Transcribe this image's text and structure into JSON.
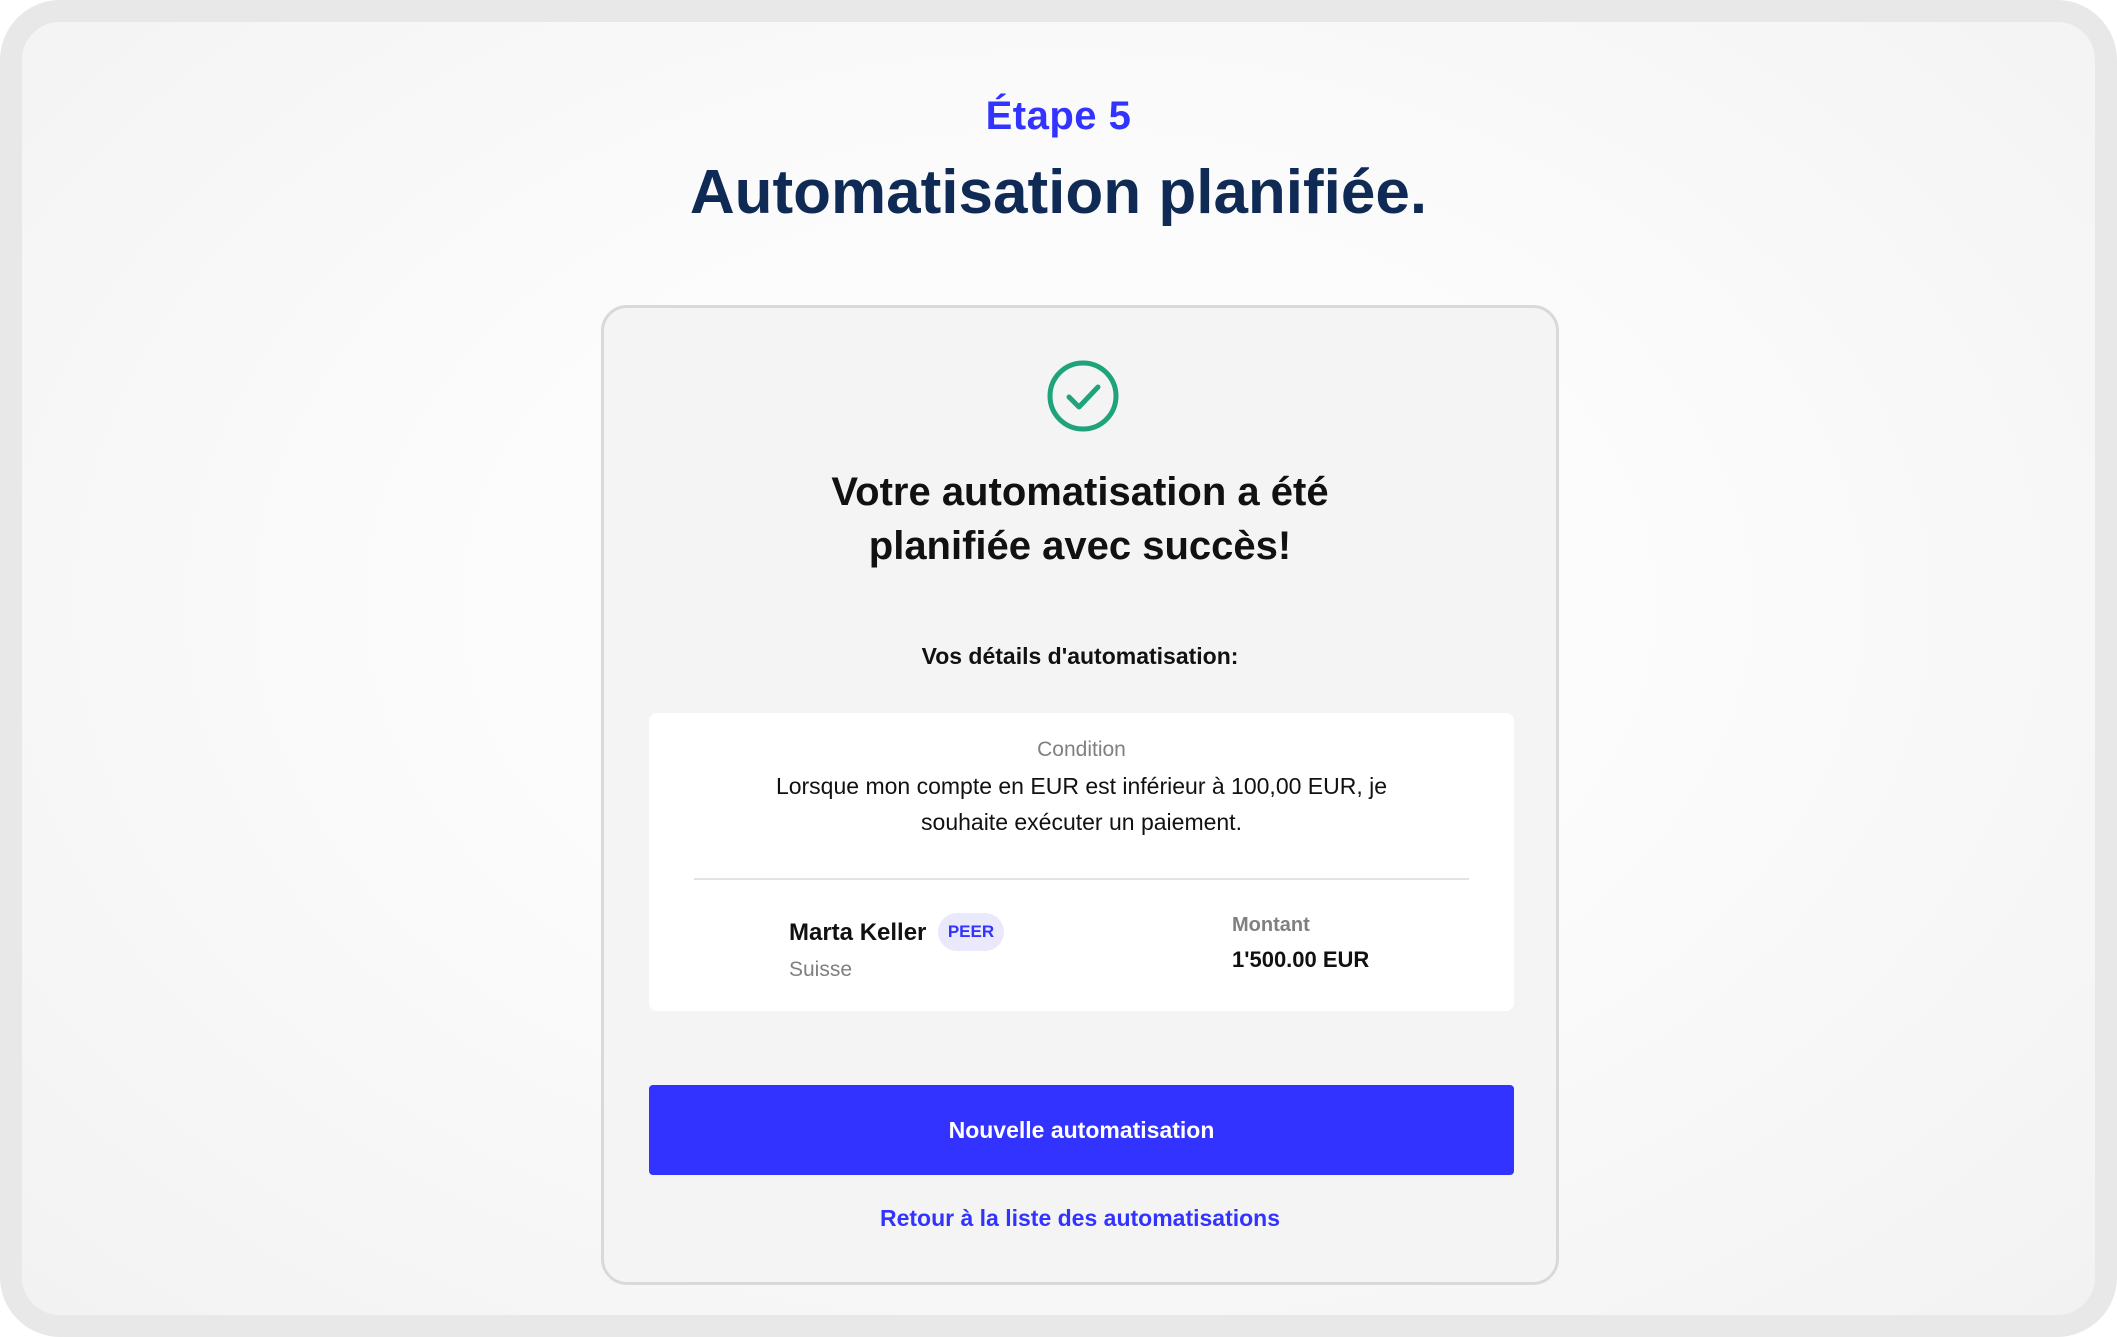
{
  "header": {
    "step": "Étape 5",
    "title": "Automatisation planifiée."
  },
  "card": {
    "success_icon": "check-circle-icon",
    "success_line1": "Votre automatisation a été",
    "success_line2": "planifiée avec succès!",
    "details_heading": "Vos détails d'automatisation:",
    "condition": {
      "label": "Condition",
      "line1": "Lorsque mon compte en EUR est inférieur à 100,00 EUR, je",
      "line2": "souhaite exécuter un paiement."
    },
    "recipient": {
      "name": "Marta Keller",
      "badge": "PEER",
      "country": "Suisse"
    },
    "amount": {
      "label": "Montant",
      "value": "1'500.00 EUR"
    },
    "primary_button": "Nouvelle automatisation",
    "back_link": "Retour à la liste des automatisations"
  },
  "colors": {
    "accent": "#3333ff",
    "title": "#0f2a55",
    "success": "#1fa37a"
  }
}
